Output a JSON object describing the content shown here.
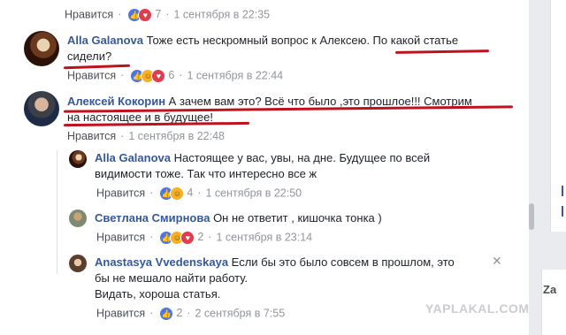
{
  "top": {
    "like": "Нравится",
    "count": "7",
    "time": "1 сентября в 22:35"
  },
  "c1": {
    "name": "Alla Galanova",
    "text_line1": "Тоже есть нескромный вопрос к Алексею. По какой статье",
    "text_line2": "сидели?",
    "like": "Нравится",
    "count": "6",
    "time": "1 сентября в 22:44"
  },
  "c2": {
    "name": "Алексей Кокорин",
    "text_line1": "А зачем вам это? Всё что было ,это прошлое!!! Смотрим",
    "text_line2": "на настоящее и в будущее!",
    "like": "Нравится",
    "time": "1 сентября в 22:48"
  },
  "r1": {
    "name": "Alla Galanova",
    "text_line1": "Настоящее у вас, увы, на дне. Будущее по всей",
    "text_line2": "видимости тоже. Так что интересно все ж",
    "like": "Нравится",
    "count": "4",
    "time": "1 сентября в 22:50"
  },
  "r2": {
    "name": "Светлана Смирнова",
    "text_line1": "Он не ответит , кишочка тонка )",
    "like": "Нравится",
    "count": "2",
    "time": "1 сентября в 23:14"
  },
  "r3": {
    "name": "Anastasya Vvedenskaya",
    "text_line1": "Если бы это было совсем в прошлом, это",
    "text_line2": "бы не мешало найти работу.",
    "text_line3": "Видать, хороша статья.",
    "like": "Нравится",
    "count": "2",
    "time": "2 сентября в 7:55"
  },
  "side": {
    "letters": "Za"
  },
  "watermark": "YAPLAKAL.COM",
  "colors": {
    "name": "#365899",
    "meta": "#90949c",
    "underline": "#c0111f",
    "like_icon": "#4a76e8"
  }
}
